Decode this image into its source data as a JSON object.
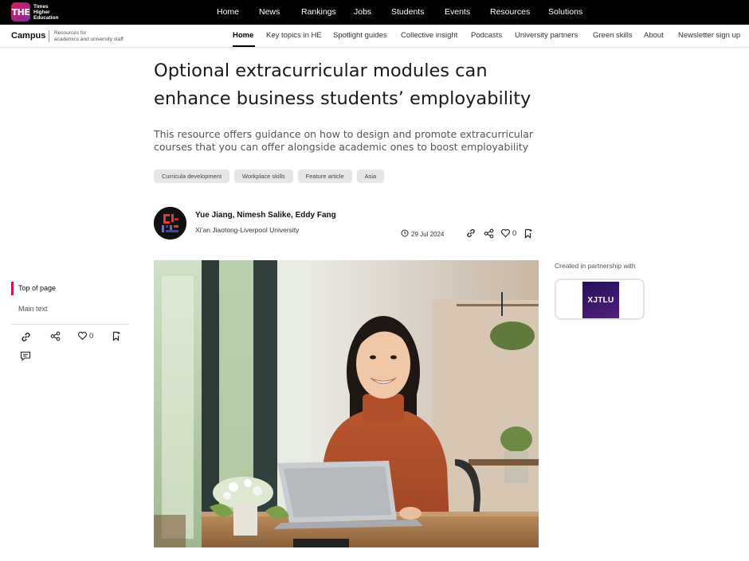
{
  "brand": {
    "logo_mark": "THE",
    "logo_lines": [
      "Times",
      "Higher",
      "Education"
    ]
  },
  "topnav": [
    "Home",
    "News",
    "Rankings",
    "Jobs",
    "Students",
    "Events",
    "Resources",
    "Solutions"
  ],
  "subheader": {
    "section": "Campus",
    "tagline_lines": [
      "Resources for",
      "academics and university staff"
    ],
    "nav": [
      "Home",
      "Key topics in HE",
      "Spotlight guides",
      "Collective insight",
      "Podcasts",
      "University partners",
      "Green skills",
      "About",
      "Newsletter sign up"
    ],
    "active": "Home"
  },
  "article": {
    "title_lines": [
      "Optional extracurricular modules can",
      "enhance business students’ employability"
    ],
    "subtitle_lines": [
      "This resource offers guidance on how to design and promote extracurricular",
      "courses that you can offer alongside academic ones to boost employability"
    ],
    "tags": [
      "Curricula development",
      "Workplace skills",
      "Feature article",
      "Asia"
    ],
    "authors": "Yue Jiang, Nimesh Salike, Eddy Fang",
    "institution": "Xi’an Jiaotong-Liverpool University",
    "date": "29 Jul 2024",
    "likes": "0"
  },
  "partner": {
    "label": "Created in partnership with",
    "logo_text": "XJTLU"
  },
  "sidebar": {
    "toc": [
      "Top of page",
      "Main text"
    ],
    "likes": "0"
  },
  "icons": [
    "link-icon",
    "share-icon",
    "heart-icon",
    "bookmark-icon",
    "comment-icon",
    "clock-icon"
  ],
  "colors": {
    "accent": "#c2185b",
    "topbar": "#000000",
    "partner": "#3a1670"
  }
}
